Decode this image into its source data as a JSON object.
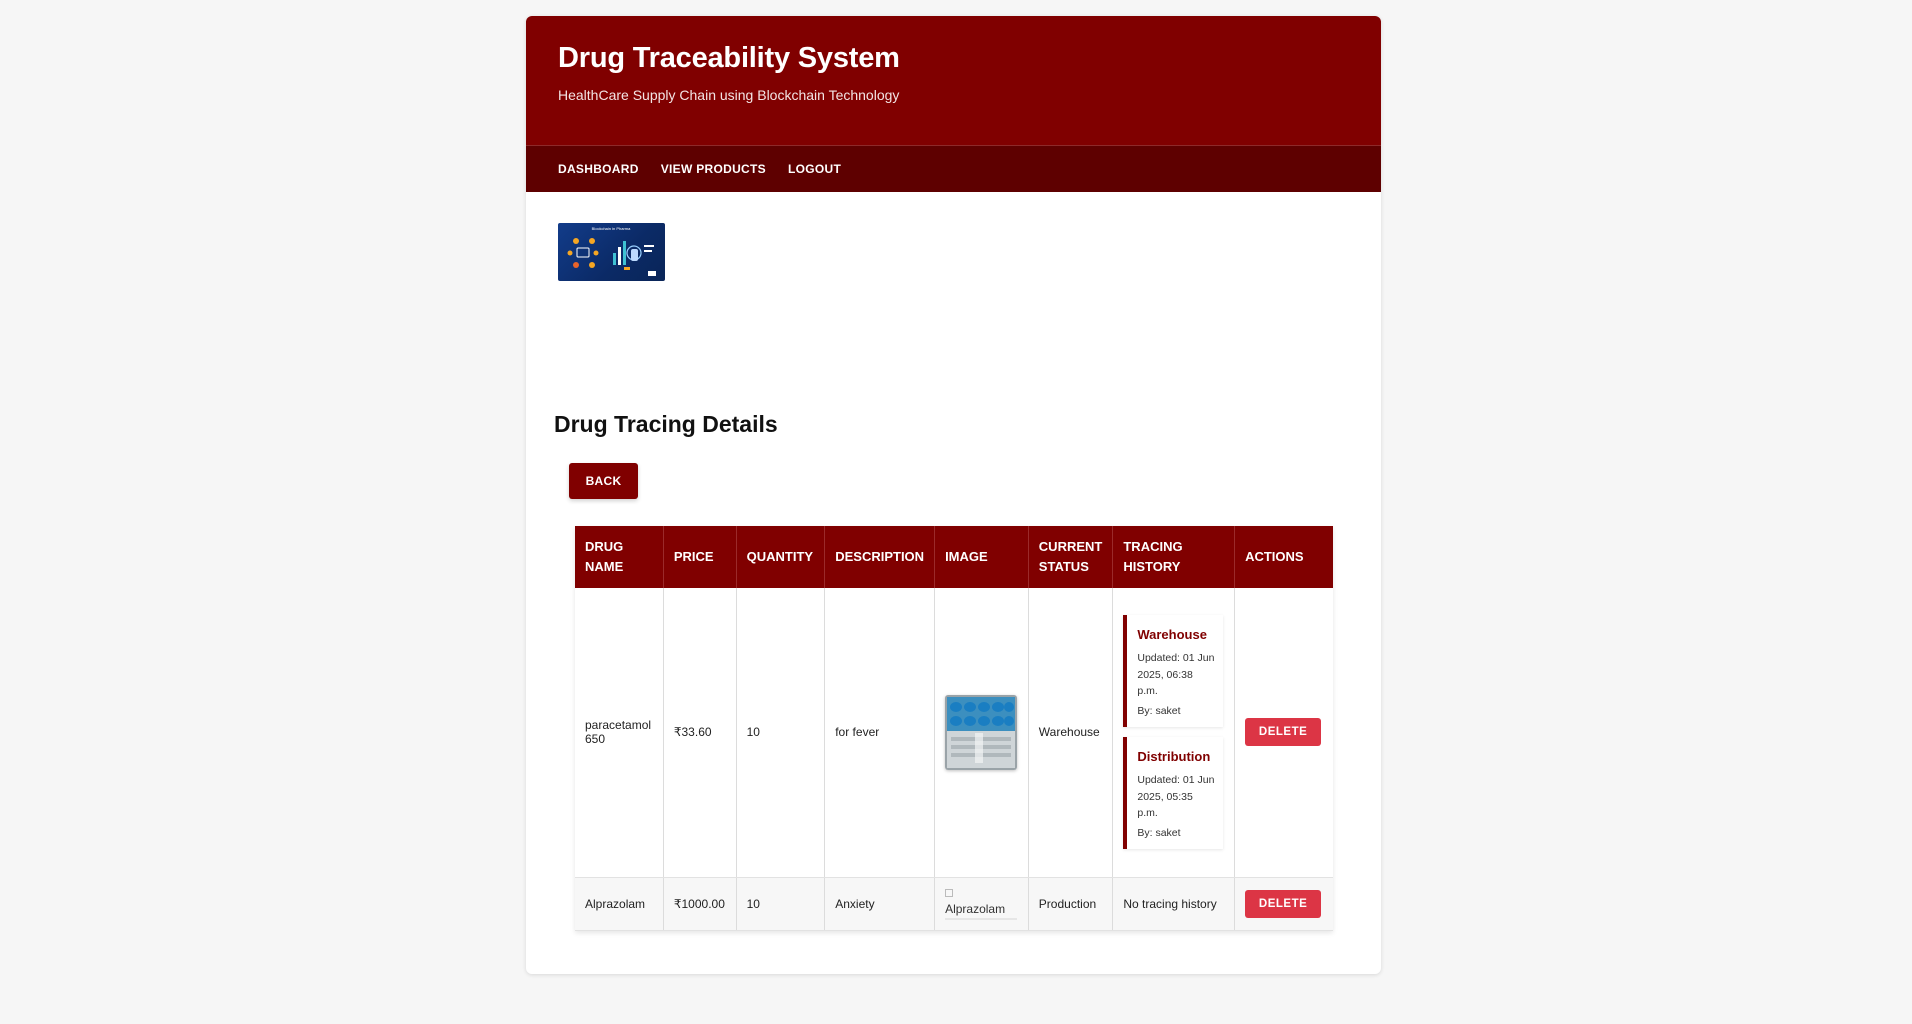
{
  "header": {
    "title": "Drug Traceability System",
    "subtitle": "HealthCare Supply Chain using Blockchain Technology"
  },
  "nav": {
    "items": [
      "DASHBOARD",
      "VIEW PRODUCTS",
      "LOGOUT"
    ]
  },
  "banner": {
    "caption": "Blockchain in Pharma"
  },
  "section": {
    "title": "Drug Tracing Details",
    "back_label": "BACK"
  },
  "table": {
    "headers": [
      "DRUG NAME",
      "PRICE",
      "QUANTITY",
      "DESCRIPTION",
      "IMAGE",
      "CURRENT STATUS",
      "TRACING HISTORY",
      "ACTIONS"
    ],
    "rows": [
      {
        "name": "paracetamol 650",
        "price": "₹33.60",
        "quantity": "10",
        "description": "for fever",
        "image_alt": "",
        "status": "Warehouse",
        "history": [
          {
            "stage": "Warehouse",
            "updated": "Updated: 01 Jun 2025, 06:38 p.m.",
            "by": "By: saket"
          },
          {
            "stage": "Distribution",
            "updated": "Updated: 01 Jun 2025, 05:35 p.m.",
            "by": "By: saket"
          }
        ],
        "action": "DELETE"
      },
      {
        "name": "Alprazolam",
        "price": "₹1000.00",
        "quantity": "10",
        "description": "Anxiety",
        "image_alt": "Alprazolam",
        "status": "Production",
        "history_text": "No tracing history",
        "action": "DELETE"
      }
    ]
  },
  "colors": {
    "brand": "#800000",
    "nav": "#5e0000",
    "danger": "#dc3545"
  },
  "icons": [
    "blockchain-banner-image",
    "drug-blister-image",
    "broken-image-icon"
  ]
}
